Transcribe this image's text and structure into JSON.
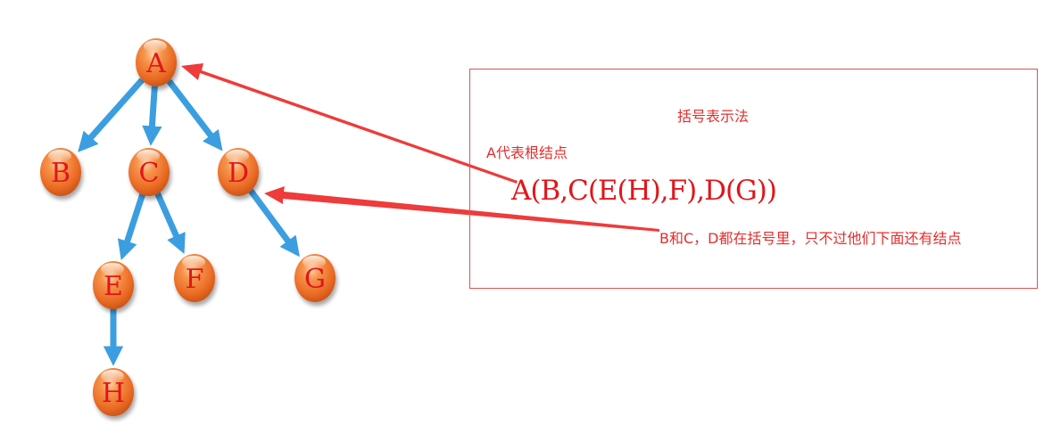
{
  "tree": {
    "nodes": [
      {
        "id": "A",
        "label": "A"
      },
      {
        "id": "B",
        "label": "B"
      },
      {
        "id": "C",
        "label": "C"
      },
      {
        "id": "D",
        "label": "D"
      },
      {
        "id": "E",
        "label": "E"
      },
      {
        "id": "F",
        "label": "F"
      },
      {
        "id": "G",
        "label": "G"
      },
      {
        "id": "H",
        "label": "H"
      }
    ],
    "edges": [
      {
        "from": "A",
        "to": "B"
      },
      {
        "from": "A",
        "to": "C"
      },
      {
        "from": "A",
        "to": "D"
      },
      {
        "from": "C",
        "to": "E"
      },
      {
        "from": "C",
        "to": "F"
      },
      {
        "from": "D",
        "to": "G"
      },
      {
        "from": "E",
        "to": "H"
      }
    ]
  },
  "annotation": {
    "title": "括号表示法",
    "root_note": "A代表根结点",
    "formula": "A(B,C(E(H),F),D(G))",
    "child_note": "B和C，D都在括号里，只不过他们下面还有结点"
  },
  "colors": {
    "node_fill": "#f07a34",
    "node_label": "#e0161b",
    "tree_edge": "#3b9ee0",
    "annotation_arrow": "#ee3b3b",
    "box_border": "#d9534f",
    "annotation_text": "#e42d2d"
  }
}
